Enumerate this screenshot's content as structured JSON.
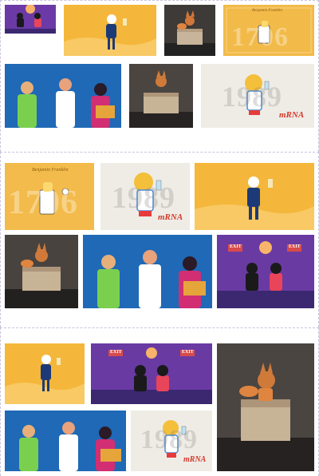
{
  "gallery": {
    "sections": [
      {
        "name": "gallery-section-1"
      },
      {
        "name": "gallery-section-2"
      },
      {
        "name": "gallery-section-3"
      }
    ],
    "year_1706": "1706",
    "year_1989": "1989",
    "mrna_label": "mRNA",
    "script_label": "Benjamin Franklin",
    "exit_label": "EXIT"
  },
  "colors": {
    "border": "#c9c3de",
    "gold": "#f4b73b",
    "cream": "#efece6",
    "blue": "#1f69b6",
    "purple": "#4b2f8a",
    "mrna_red": "#d43a2a"
  }
}
